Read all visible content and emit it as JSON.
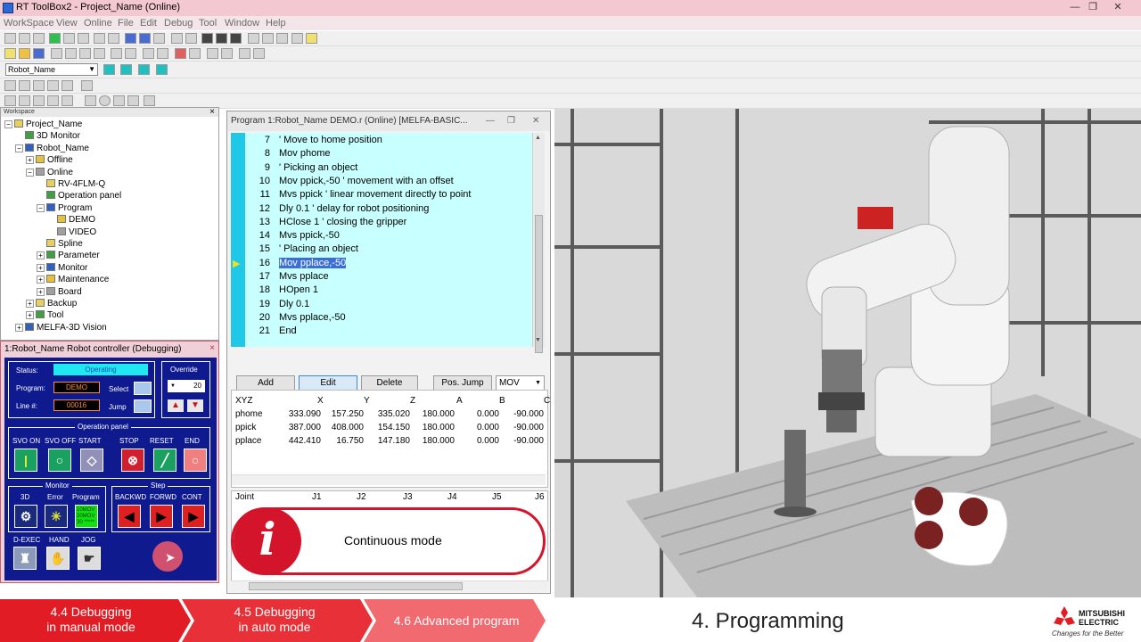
{
  "window": {
    "title": "RT ToolBox2 - Project_Name  (Online)",
    "buttons": {
      "minimize": "—",
      "maximize": "❐",
      "close": "✕"
    }
  },
  "menu": [
    "WorkSpace",
    "View",
    "Online",
    "File",
    "Edit",
    "Debug",
    "Tool",
    "Window",
    "Help"
  ],
  "toolbar": {
    "robot_select": "Robot_Name"
  },
  "workspace": {
    "header": "Workspace",
    "close": "×",
    "tree": [
      {
        "label": "Project_Name",
        "level": 0
      },
      {
        "label": "3D Monitor",
        "level": 1
      },
      {
        "label": "Robot_Name",
        "level": 1
      },
      {
        "label": "Offline",
        "level": 2
      },
      {
        "label": "Online",
        "level": 2
      },
      {
        "label": "RV-4FLM-Q",
        "level": 3
      },
      {
        "label": "Operation panel",
        "level": 3
      },
      {
        "label": "Program",
        "level": 3
      },
      {
        "label": "DEMO",
        "level": 4
      },
      {
        "label": "VIDEO",
        "level": 4
      },
      {
        "label": "Spline",
        "level": 3
      },
      {
        "label": "Parameter",
        "level": 3
      },
      {
        "label": "Monitor",
        "level": 3
      },
      {
        "label": "Maintenance",
        "level": 3
      },
      {
        "label": "Board",
        "level": 3
      },
      {
        "label": "Backup",
        "level": 2
      },
      {
        "label": "Tool",
        "level": 2
      },
      {
        "label": "MELFA-3D Vision",
        "level": 1
      }
    ]
  },
  "controller": {
    "title": "1:Robot_Name  Robot controller (Debugging)",
    "close": "×",
    "status_label": "Status:",
    "status_value": "Operating",
    "program_label": "Program:",
    "program_value": "DEMO",
    "line_label": "Line #:",
    "line_value": "00016",
    "select_label": "Select",
    "jump_label": "Jump",
    "override_label": "Override",
    "override_value": "20",
    "operation_panel_label": "Operation panel",
    "op_buttons": [
      "SVO ON",
      "SVO OFF",
      "START",
      "STOP",
      "RESET",
      "END"
    ],
    "monitor_label": "Monitor",
    "monitor_buttons": [
      "3D",
      "Error",
      "Program"
    ],
    "program_lcd": [
      "10MOV",
      "20MOV",
      "30 *****"
    ],
    "step_label": "Step",
    "step_buttons": [
      "BACKWD",
      "FORWD",
      "CONT"
    ],
    "extra_buttons": [
      "D-EXEC",
      "HAND",
      "JOG"
    ]
  },
  "program_window": {
    "title": "Program 1:Robot_Name DEMO.r (Online)   [MELFA-BASIC...",
    "current_line": 16,
    "lines": [
      {
        "n": "7",
        "text": "' Move to home position"
      },
      {
        "n": "8",
        "text": "Mov phome"
      },
      {
        "n": "9",
        "text": "' Picking an object"
      },
      {
        "n": "10",
        "text": "Mov ppick,-50 ' movement with an offset"
      },
      {
        "n": "11",
        "text": "Mvs ppick ' linear movement directly to point"
      },
      {
        "n": "12",
        "text": "Dly 0.1 ' delay for robot positioning"
      },
      {
        "n": "13",
        "text": "HClose 1 ' closing the gripper"
      },
      {
        "n": "14",
        "text": "Mvs ppick,-50"
      },
      {
        "n": "15",
        "text": "' Placing an object"
      },
      {
        "n": "16",
        "text": "Mov pplace,-50"
      },
      {
        "n": "17",
        "text": "Mvs pplace"
      },
      {
        "n": "18",
        "text": "HOpen 1"
      },
      {
        "n": "19",
        "text": "Dly 0.1"
      },
      {
        "n": "20",
        "text": "Mvs pplace,-50"
      },
      {
        "n": "21",
        "text": "End"
      }
    ],
    "buttons": {
      "add": "Add",
      "edit": "Edit",
      "delete": "Delete",
      "pos_jump": "Pos. Jump",
      "mov_select": "MOV"
    },
    "pos_headers": [
      "XYZ",
      "X",
      "Y",
      "Z",
      "A",
      "B",
      "C"
    ],
    "pos_rows": [
      [
        "phome",
        "333.090",
        "157.250",
        "335.020",
        "180.000",
        "0.000",
        "-90.000"
      ],
      [
        "ppick",
        "387.000",
        "408.000",
        "154.150",
        "180.000",
        "0.000",
        "-90.000"
      ],
      [
        "pplace",
        "442.410",
        "16.750",
        "147.180",
        "180.000",
        "0.000",
        "-90.000"
      ]
    ],
    "joint_headers": [
      "Joint",
      "J1",
      "J2",
      "J3",
      "J4",
      "J5",
      "J6"
    ],
    "info_text": "Continuous mode",
    "info_icon": "i"
  },
  "footer": {
    "nav": [
      {
        "label_1": "4.4 Debugging",
        "label_2": "in manual mode"
      },
      {
        "label_1": "4.5 Debugging",
        "label_2": "in auto mode"
      },
      {
        "label_1": "4.6 Advanced program",
        "label_2": ""
      }
    ],
    "section_title": "4. Programming",
    "logo_line1": "MITSUBISHI",
    "logo_line2": "ELECTRIC",
    "logo_tagline": "Changes for the Better",
    "nav_color": "#e21c24",
    "nav_color_dark": "#c8141c",
    "nav_color_light": "#f08a8e"
  }
}
